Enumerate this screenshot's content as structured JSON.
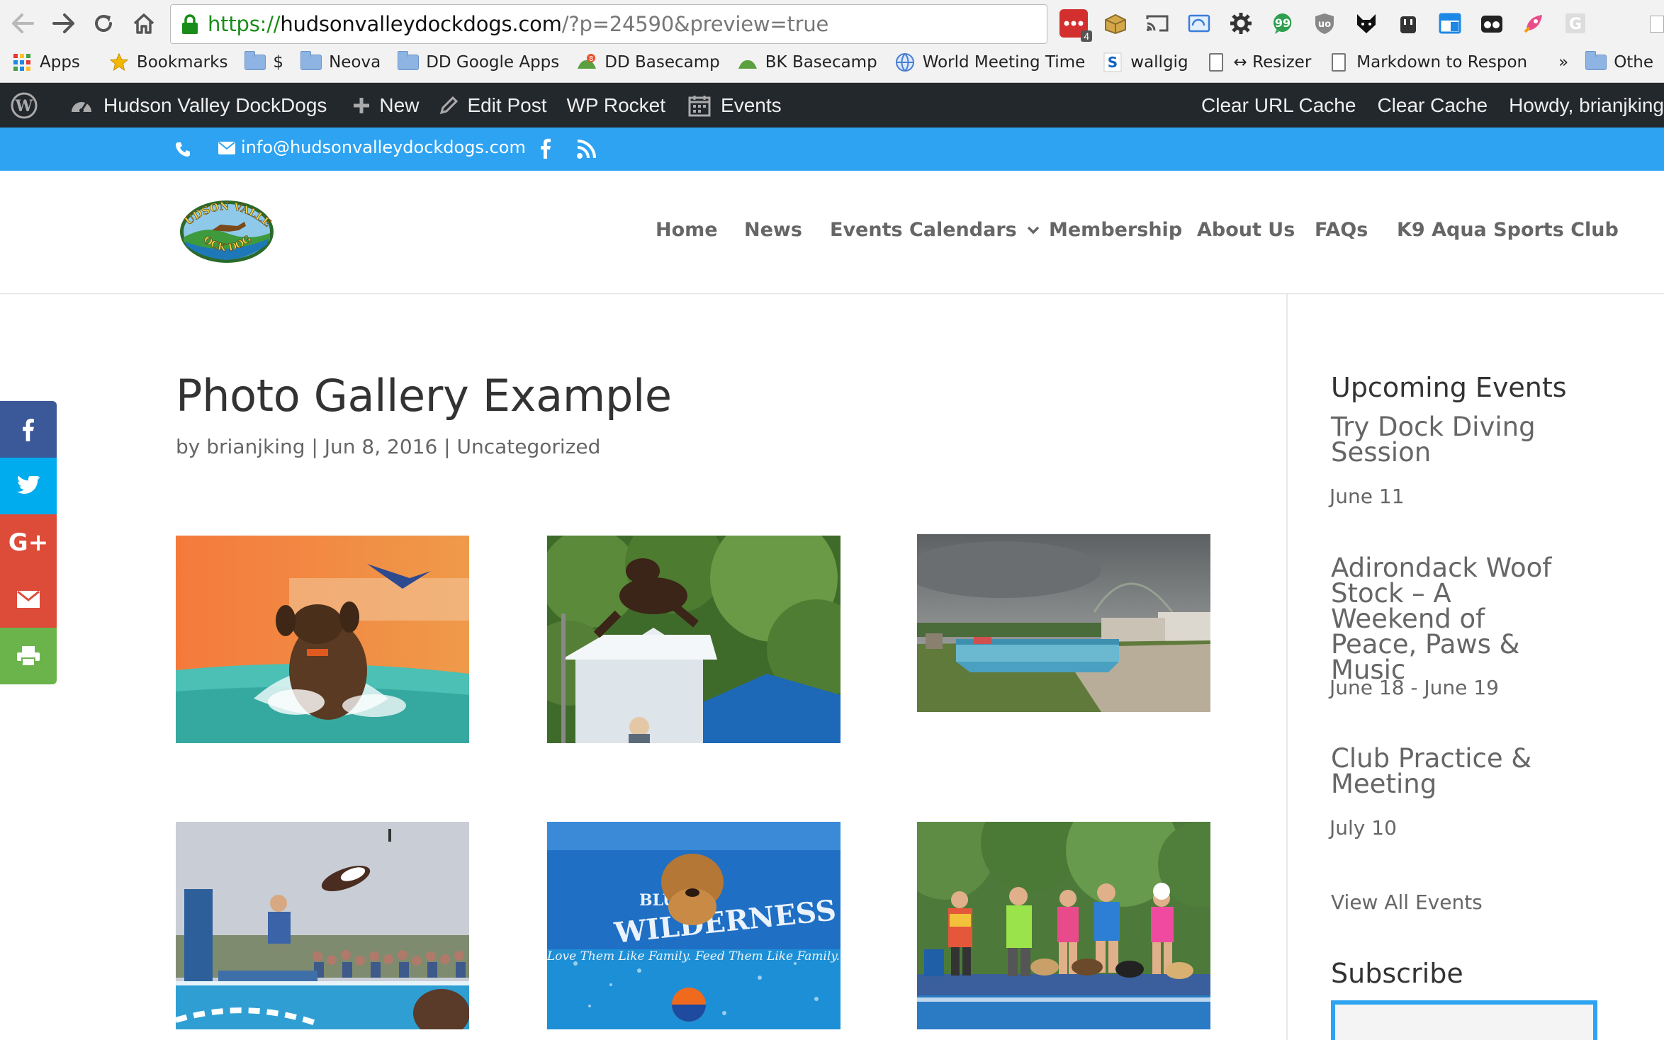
{
  "browser": {
    "url_protocol": "https://",
    "url_host": "hudsonvalleydockdogs.com",
    "url_path": "/?p=24590&preview=true",
    "ext_badge": "4",
    "bookmarks": [
      {
        "label": "Apps"
      },
      {
        "label": "Bookmarks"
      },
      {
        "label": "$"
      },
      {
        "label": "Neova"
      },
      {
        "label": "DD Google Apps"
      },
      {
        "label": "DD Basecamp"
      },
      {
        "label": "BK Basecamp"
      },
      {
        "label": "World Meeting Time"
      },
      {
        "label": "wallgig"
      },
      {
        "label": "↔ Resizer"
      },
      {
        "label": "Markdown to Respon"
      },
      {
        "label": "»"
      },
      {
        "label": "Othe"
      }
    ]
  },
  "adminbar": {
    "site": "Hudson Valley DockDogs",
    "new": "New",
    "edit_post": "Edit Post",
    "wp_rocket": "WP Rocket",
    "events": "Events",
    "clear_url_cache": "Clear URL Cache",
    "clear_cache": "Clear Cache",
    "howdy": "Howdy, brianjking"
  },
  "topbar": {
    "email": "info@hudsonvalleydockdogs.com"
  },
  "logo": {
    "line1": "HUDSON VALLEY",
    "line2": "DOCK DOGS"
  },
  "nav": {
    "items": [
      "Home",
      "News",
      "Events Calendars",
      "Membership",
      "About Us",
      "FAQs",
      "K9 Aqua Sports Club"
    ]
  },
  "post": {
    "title": "Photo Gallery Example",
    "by": "by ",
    "author": "brianjking",
    "sep1": " | ",
    "date": "Jun 8, 2016",
    "sep2": " | ",
    "category": "Uncategorized"
  },
  "gallery_banner_text": [
    "BLUE",
    "WILDERNESS",
    "Love Them Like Family. Feed Them Like Family."
  ],
  "sidebar": {
    "upcoming_heading": "Upcoming Events",
    "events": [
      {
        "title": "Try Dock Diving Session",
        "date": "June 11"
      },
      {
        "title": "Adirondack Woof Stock – A Weekend of Peace, Paws & Music",
        "date": "June 18 - June 19"
      },
      {
        "title": "Club Practice & Meeting",
        "date": "July 10"
      }
    ],
    "view_all": "View All Events",
    "subscribe_heading": "Subscribe"
  },
  "colors": {
    "accent": "#2ea3f2",
    "adminbar": "#23282d",
    "facebook": "#3b5998",
    "twitter": "#00aced",
    "googleplus": "#dd4b39",
    "email": "#dd4b39",
    "print": "#6bb44b"
  }
}
